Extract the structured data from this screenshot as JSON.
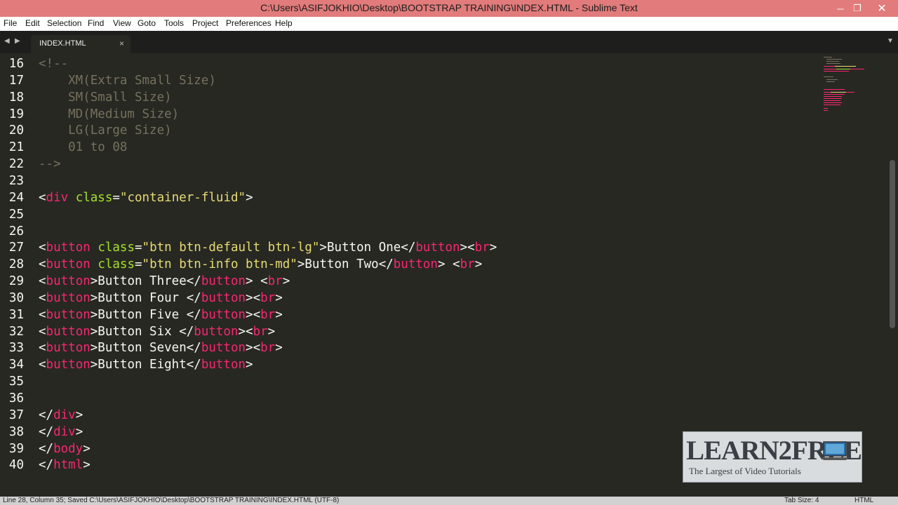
{
  "window": {
    "title": "C:\\Users\\ASIFJOKHIO\\Desktop\\BOOTSTRAP TRAINING\\INDEX.HTML - Sublime Text",
    "minimize_glyph": "─",
    "maximize_glyph": "❐",
    "close_glyph": "✕"
  },
  "menu": {
    "items": [
      "File",
      "Edit",
      "Selection",
      "Find",
      "View",
      "Goto",
      "Tools",
      "Project",
      "Preferences",
      "Help"
    ]
  },
  "tabs": {
    "nav_left": "◀",
    "nav_right": "▶",
    "active": "INDEX.HTML",
    "close_glyph": "×",
    "menu_glyph": "▼"
  },
  "editor": {
    "lines": [
      {
        "n": "16",
        "t": [
          [
            "com",
            "<!--"
          ]
        ]
      },
      {
        "n": "17",
        "t": [
          [
            "com",
            "    XM(Extra Small Size)"
          ]
        ]
      },
      {
        "n": "18",
        "t": [
          [
            "com",
            "    SM(Small Size)"
          ]
        ]
      },
      {
        "n": "19",
        "t": [
          [
            "com",
            "    MD(Medium Size)"
          ]
        ]
      },
      {
        "n": "20",
        "t": [
          [
            "com",
            "    LG(Large Size)"
          ]
        ]
      },
      {
        "n": "21",
        "t": [
          [
            "com",
            "    01 to 08"
          ]
        ]
      },
      {
        "n": "22",
        "t": [
          [
            "com",
            "-->"
          ]
        ]
      },
      {
        "n": "23",
        "t": []
      },
      {
        "n": "24",
        "t": [
          [
            "txt",
            "<"
          ],
          [
            "tag",
            "div"
          ],
          [
            "txt",
            " "
          ],
          [
            "attr",
            "class"
          ],
          [
            "txt",
            "="
          ],
          [
            "str",
            "\"container-fluid\""
          ],
          [
            "txt",
            ">"
          ]
        ]
      },
      {
        "n": "25",
        "t": []
      },
      {
        "n": "26",
        "t": []
      },
      {
        "n": "27",
        "t": [
          [
            "txt",
            "<"
          ],
          [
            "tag",
            "button"
          ],
          [
            "txt",
            " "
          ],
          [
            "attr",
            "class"
          ],
          [
            "txt",
            "="
          ],
          [
            "str",
            "\"btn btn-default btn-lg\""
          ],
          [
            "txt",
            ">Button One</"
          ],
          [
            "tag",
            "button"
          ],
          [
            "txt",
            "><"
          ],
          [
            "tag",
            "br"
          ],
          [
            "txt",
            ">"
          ]
        ]
      },
      {
        "n": "28",
        "t": [
          [
            "txt",
            "<"
          ],
          [
            "tag",
            "button"
          ],
          [
            "txt",
            " "
          ],
          [
            "attr",
            "class"
          ],
          [
            "txt",
            "="
          ],
          [
            "str",
            "\"btn btn-info btn-md\""
          ],
          [
            "txt",
            ">Button Two</"
          ],
          [
            "tag",
            "button"
          ],
          [
            "txt",
            "> <"
          ],
          [
            "tag",
            "br"
          ],
          [
            "txt",
            ">"
          ]
        ]
      },
      {
        "n": "29",
        "t": [
          [
            "txt",
            "<"
          ],
          [
            "tag",
            "button"
          ],
          [
            "txt",
            ">Button Three</"
          ],
          [
            "tag",
            "button"
          ],
          [
            "txt",
            "> <"
          ],
          [
            "tag",
            "br"
          ],
          [
            "txt",
            ">"
          ]
        ]
      },
      {
        "n": "30",
        "t": [
          [
            "txt",
            "<"
          ],
          [
            "tag",
            "button"
          ],
          [
            "txt",
            ">Button Four </"
          ],
          [
            "tag",
            "button"
          ],
          [
            "txt",
            "><"
          ],
          [
            "tag",
            "br"
          ],
          [
            "txt",
            ">"
          ]
        ]
      },
      {
        "n": "31",
        "t": [
          [
            "txt",
            "<"
          ],
          [
            "tag",
            "button"
          ],
          [
            "txt",
            ">Button Five </"
          ],
          [
            "tag",
            "button"
          ],
          [
            "txt",
            "><"
          ],
          [
            "tag",
            "br"
          ],
          [
            "txt",
            ">"
          ]
        ]
      },
      {
        "n": "32",
        "t": [
          [
            "txt",
            "<"
          ],
          [
            "tag",
            "button"
          ],
          [
            "txt",
            ">Button Six </"
          ],
          [
            "tag",
            "button"
          ],
          [
            "txt",
            "><"
          ],
          [
            "tag",
            "br"
          ],
          [
            "txt",
            ">"
          ]
        ]
      },
      {
        "n": "33",
        "t": [
          [
            "txt",
            "<"
          ],
          [
            "tag",
            "button"
          ],
          [
            "txt",
            ">Button Seven</"
          ],
          [
            "tag",
            "button"
          ],
          [
            "txt",
            "><"
          ],
          [
            "tag",
            "br"
          ],
          [
            "txt",
            ">"
          ]
        ]
      },
      {
        "n": "34",
        "t": [
          [
            "txt",
            "<"
          ],
          [
            "tag",
            "button"
          ],
          [
            "txt",
            ">Button Eight</"
          ],
          [
            "tag",
            "button"
          ],
          [
            "txt",
            ">"
          ]
        ]
      },
      {
        "n": "35",
        "t": []
      },
      {
        "n": "36",
        "t": []
      },
      {
        "n": "37",
        "t": [
          [
            "txt",
            "</"
          ],
          [
            "tag",
            "div"
          ],
          [
            "txt",
            ">"
          ]
        ]
      },
      {
        "n": "38",
        "t": [
          [
            "txt",
            "</"
          ],
          [
            "tag",
            "div"
          ],
          [
            "txt",
            ">"
          ]
        ]
      },
      {
        "n": "39",
        "t": [
          [
            "txt",
            "</"
          ],
          [
            "tag",
            "body"
          ],
          [
            "txt",
            ">"
          ]
        ]
      },
      {
        "n": "40",
        "t": [
          [
            "txt",
            "</"
          ],
          [
            "tag",
            "html"
          ],
          [
            "txt",
            ">"
          ]
        ]
      }
    ]
  },
  "watermark": {
    "brand": "LEARN2FREE",
    "tagline": "The Largest of Video Tutorials"
  },
  "status": {
    "left": "Line 28, Column 35; Saved C:\\Users\\ASIFJOKHIO\\Desktop\\BOOTSTRAP TRAINING\\INDEX.HTML (UTF-8)",
    "tab_size": "Tab Size: 4",
    "syntax": "HTML"
  },
  "colors": {
    "titlebar": "#e27b7b",
    "editor_bg": "#272822",
    "tag": "#f92672",
    "attribute": "#a6e22e",
    "string": "#e6db74",
    "comment": "#75715e",
    "text": "#f8f8f2"
  }
}
